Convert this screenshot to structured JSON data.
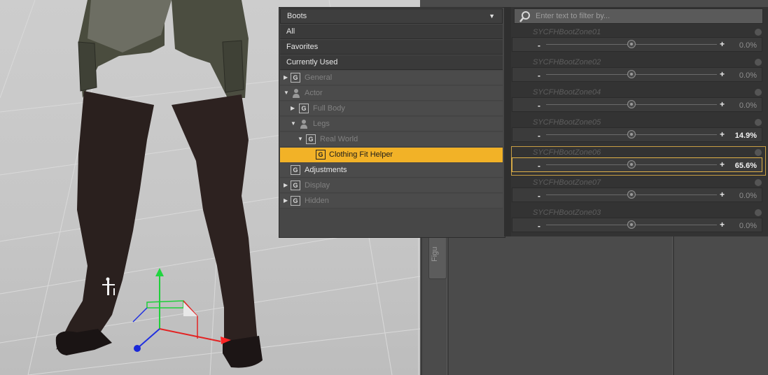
{
  "category_panel": {
    "dropdown": {
      "label": "Boots",
      "icon": "dropdown-arrow-icon"
    },
    "top_items": [
      {
        "label": "All"
      },
      {
        "label": "Favorites"
      },
      {
        "label": "Currently Used"
      }
    ],
    "tree": [
      {
        "label": "General",
        "expanded": false,
        "kind": "group"
      },
      {
        "label": "Actor",
        "expanded": true,
        "kind": "person"
      },
      {
        "label": "Full Body",
        "expanded": false,
        "kind": "group"
      },
      {
        "label": "Legs",
        "expanded": true,
        "kind": "person"
      },
      {
        "label": "Real World",
        "expanded": true,
        "kind": "group"
      },
      {
        "label": "Clothing Fit Helper",
        "selected": true,
        "kind": "group"
      },
      {
        "label": "Adjustments",
        "kind": "group"
      },
      {
        "label": "Display",
        "expanded": false,
        "kind": "group"
      },
      {
        "label": "Hidden",
        "expanded": false,
        "kind": "group"
      }
    ]
  },
  "param_panel": {
    "filter": {
      "placeholder": "Enter text to filter by...",
      "icon": "search-icon"
    },
    "params": [
      {
        "name": "SYCFHBootZone01",
        "value": "0.0%",
        "level": 0.0,
        "active": false
      },
      {
        "name": "SYCFHBootZone02",
        "value": "0.0%",
        "level": 0.0,
        "active": false
      },
      {
        "name": "SYCFHBootZone04",
        "value": "0.0%",
        "level": 0.0,
        "active": false
      },
      {
        "name": "SYCFHBootZone05",
        "value": "14.9%",
        "level": 0.149,
        "active": false
      },
      {
        "name": "SYCFHBootZone06",
        "value": "65.6%",
        "level": 0.656,
        "active": true
      },
      {
        "name": "SYCFHBootZone07",
        "value": "0.0%",
        "level": 0.0,
        "active": false
      },
      {
        "name": "SYCFHBootZone03",
        "value": "0.0%",
        "level": 0.0,
        "active": false
      }
    ]
  },
  "side_tab": {
    "label": "Figu"
  },
  "viewport": {
    "description_icon": "universal-manipulator-icon"
  }
}
